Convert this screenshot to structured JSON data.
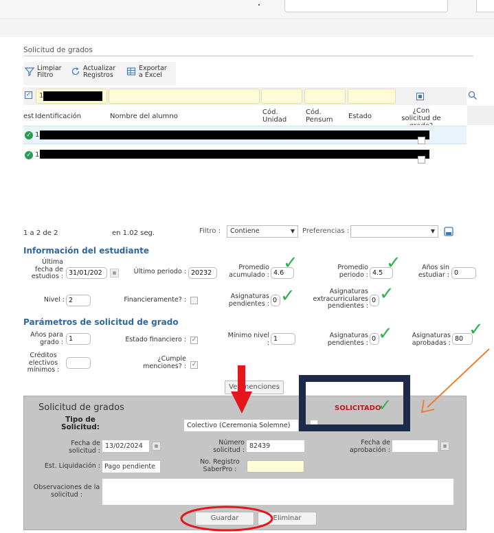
{
  "section_title": "Solicitud de grados",
  "toolbar": {
    "clear_filter": "Limpiar Filtro",
    "refresh": "Actualizar Registros",
    "export": "Exportar a Excel"
  },
  "filter_row": {
    "id_prefix": "1"
  },
  "grid": {
    "columns": [
      "est",
      "Identificación",
      "Nombre del alumno",
      "Cód. Unidad",
      "Cód. Pensum",
      "Estado",
      "¿Con solicitud de grado?"
    ],
    "rows": [
      {
        "id_prefix": "1"
      },
      {
        "id_prefix": "1"
      }
    ]
  },
  "pager": {
    "count": "1 a 2 de 2",
    "time": "en 1.02 seg.",
    "filter_label": "Filtro :",
    "filter_value": "Contiene",
    "prefs_label": "Preferencias :"
  },
  "student": {
    "title": "Información del estudiante",
    "last_study_date_label": "Última fecha de estudios :",
    "last_study_date": "31/01/202",
    "last_period_label": "Último periodo :",
    "last_period": "20232",
    "avg_cum_label": "Promedio acumulado :",
    "avg_cum": "4.6",
    "avg_period_label": "Promedio periodo :",
    "avg_period": "4.5",
    "years_label": "Años sin estudiar :",
    "years": "0",
    "level_label": "Nivel :",
    "level": "2",
    "financial_label": "Financieramente? :",
    "pending_label": "Asignaturas pendientes :",
    "pending": "0",
    "extra_label": "Asignaturas extracurriculares pendientes :",
    "extra": "0"
  },
  "params": {
    "title": "Parámetros de solicitud de grado",
    "years_label": "Años para grado :",
    "years": "1",
    "fin_state_label": "Estado financiero :",
    "min_level_label": "Mínimo nivel :",
    "min_level": "1",
    "pending_label": "Asignaturas pendientes :",
    "pending": "0",
    "approved_label": "Asignaturas aprobadas :",
    "approved": "80",
    "credits_label": "Créditos electivos mínimos :",
    "mentions_label": "¿Cumple menciones? :",
    "mentions_button": "Ver menciones"
  },
  "request": {
    "title": "Solicitud de grados",
    "status": "SOLICITADO",
    "type_label": "Tipo de Solicitud:",
    "type": "Colectivo (Ceremonia Solemne)",
    "date_label": "Fecha de solicitud :",
    "date": "13/02/2024",
    "number_label": "Número solicitud :",
    "number": "82439",
    "approval_label": "Fecha de aprobación :",
    "liquidation_label": "Est. Liquidación :",
    "liquidation": "Pago pendiente",
    "saberpro_label": "No. Registro SaberPro :",
    "saberpro": "",
    "notes_label": "Observaciones de la solicitud :",
    "save": "Guardar",
    "delete": "Eliminar"
  },
  "colors": {
    "accent_blue": "#2f67a0",
    "check_green": "#2eb24a",
    "status_red": "#c0181e",
    "annotation_orange": "#ed7d31",
    "annotation_navy": "#1e2a4a",
    "arrow_red": "#e3161b",
    "circle_red": "#e3161b"
  }
}
